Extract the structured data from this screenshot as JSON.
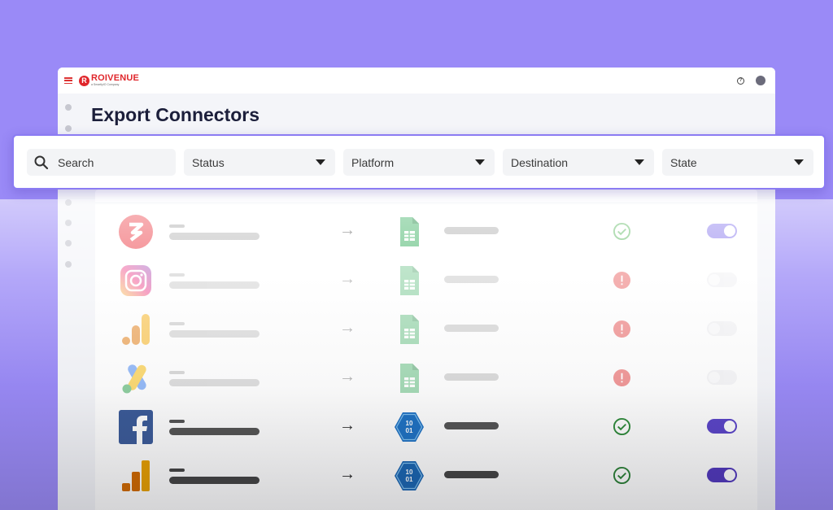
{
  "app": {
    "brand_name": "ROIVENUE",
    "brand_tagline": "a SmartlyIO Company",
    "page_title": "Export Connectors"
  },
  "filters": {
    "search_label": "Search",
    "status_label": "Status",
    "platform_label": "Platform",
    "destination_label": "Destination",
    "state_label": "State"
  },
  "colors": {
    "background": "#9a8af7",
    "accent": "#7867e8",
    "success": "#4caf50",
    "error": "#e53935",
    "brand": "#e0262b"
  },
  "connectors": [
    {
      "platform_icon": "roivenue-icon",
      "destination_icon": "google-sheets-icon",
      "status": "success",
      "enabled": true
    },
    {
      "platform_icon": "instagram-icon",
      "destination_icon": "google-sheets-icon",
      "status": "error",
      "enabled": false
    },
    {
      "platform_icon": "google-analytics-icon",
      "destination_icon": "google-sheets-icon",
      "status": "error",
      "enabled": false
    },
    {
      "platform_icon": "google-ads-icon",
      "destination_icon": "google-sheets-icon",
      "status": "error",
      "enabled": false
    },
    {
      "platform_icon": "facebook-icon",
      "destination_icon": "azure-storage-icon",
      "status": "success",
      "enabled": true
    },
    {
      "platform_icon": "google-analytics-icon",
      "destination_icon": "azure-storage-icon",
      "status": "success",
      "enabled": true
    }
  ]
}
